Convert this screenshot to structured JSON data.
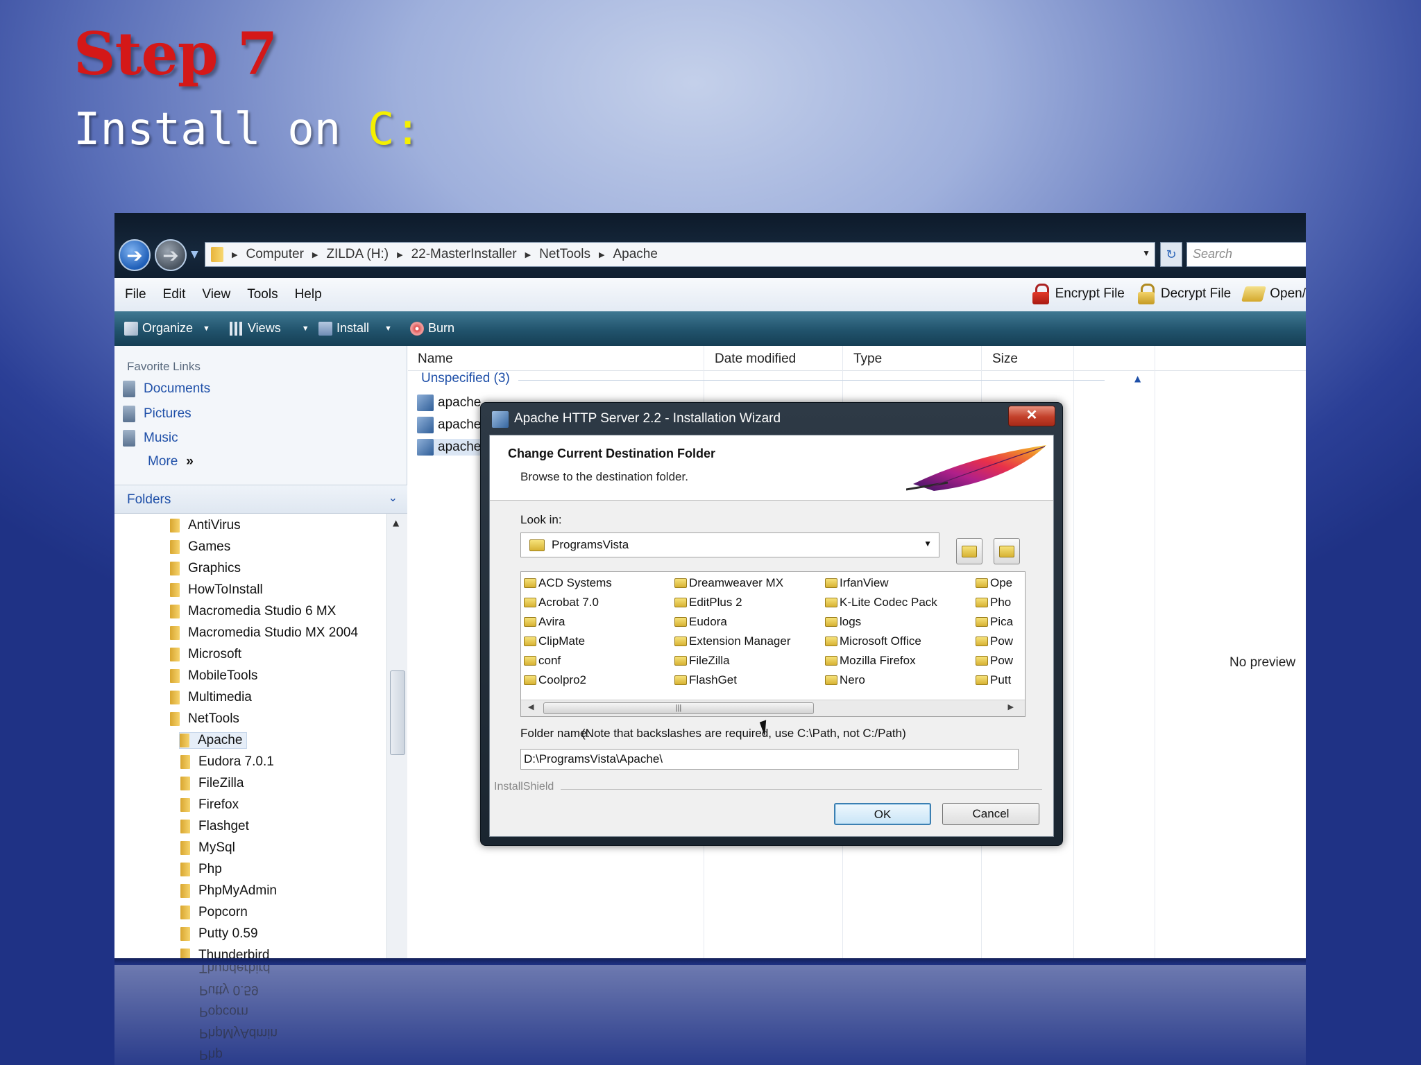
{
  "slide": {
    "title": "Step 7",
    "subtitle_prefix": "Install on",
    "subtitle_highlight": "C:"
  },
  "explorer": {
    "breadcrumbs": [
      "Computer",
      "ZILDA (H:)",
      "22-MasterInstaller",
      "NetTools",
      "Apache"
    ],
    "search_placeholder": "Search",
    "menu": [
      "File",
      "Edit",
      "View",
      "Tools",
      "Help"
    ],
    "menu_right": {
      "encrypt": "Encrypt File",
      "decrypt": "Decrypt File",
      "open": "Open/"
    },
    "toolbar": {
      "organize": "Organize",
      "views": "Views",
      "install": "Install",
      "burn": "Burn"
    },
    "favorites_title": "Favorite Links",
    "favorites": [
      "Documents",
      "Pictures",
      "Music",
      "More"
    ],
    "folders_title": "Folders",
    "tree_level1": [
      "AntiVirus",
      "Games",
      "Graphics",
      "HowToInstall",
      "Macromedia Studio 6 MX",
      "Macromedia Studio MX 2004",
      "Microsoft",
      "MobileTools",
      "Multimedia",
      "NetTools"
    ],
    "tree_level2": [
      "Apache",
      "Eudora 7.0.1",
      "FileZilla",
      "Firefox",
      "Flashget",
      "MySql",
      "Php",
      "PhpMyAdmin",
      "Popcorn",
      "Putty 0.59",
      "Thunderbird"
    ],
    "columns": [
      "Name",
      "Date modified",
      "Type",
      "Size"
    ],
    "group": "Unspecified (3)",
    "files": [
      "apache",
      "apache",
      "apache"
    ],
    "preview": "No preview"
  },
  "dialog": {
    "title": "Apache HTTP Server 2.2 - Installation Wizard",
    "close": "✕",
    "heading": "Change Current Destination Folder",
    "subheading": "Browse to the destination folder.",
    "look_in_label": "Look in:",
    "look_in_value": "ProgramsVista",
    "list": [
      [
        "ACD Systems",
        "Acrobat 7.0",
        "Avira",
        "ClipMate",
        "conf",
        "Coolpro2"
      ],
      [
        "Dreamweaver MX",
        "EditPlus 2",
        "Eudora",
        "Extension Manager",
        "FileZilla",
        "FlashGet"
      ],
      [
        "IrfanView",
        "K-Lite Codec Pack",
        "logs",
        "Microsoft Office",
        "Mozilla Firefox",
        "Nero"
      ],
      [
        "Ope",
        "Pho",
        "Pica",
        "Pow",
        "Pow",
        "Putt"
      ]
    ],
    "folder_name_label": "Folder name:",
    "folder_name_note": "(Note that backslashes are required, use C:\\Path, not C:/Path)",
    "folder_name_value": "D:\\ProgramsVista\\Apache\\",
    "brand": "InstallShield",
    "ok": "OK",
    "cancel": "Cancel"
  },
  "reflection": [
    "Thunderbird",
    "Putty 0.59",
    "Popcorn",
    "PhpMyAdmin",
    "Php"
  ],
  "colors": {
    "title_red": "#d41818",
    "highlight_yellow": "#f5f000",
    "link_blue": "#1e4fa8"
  }
}
